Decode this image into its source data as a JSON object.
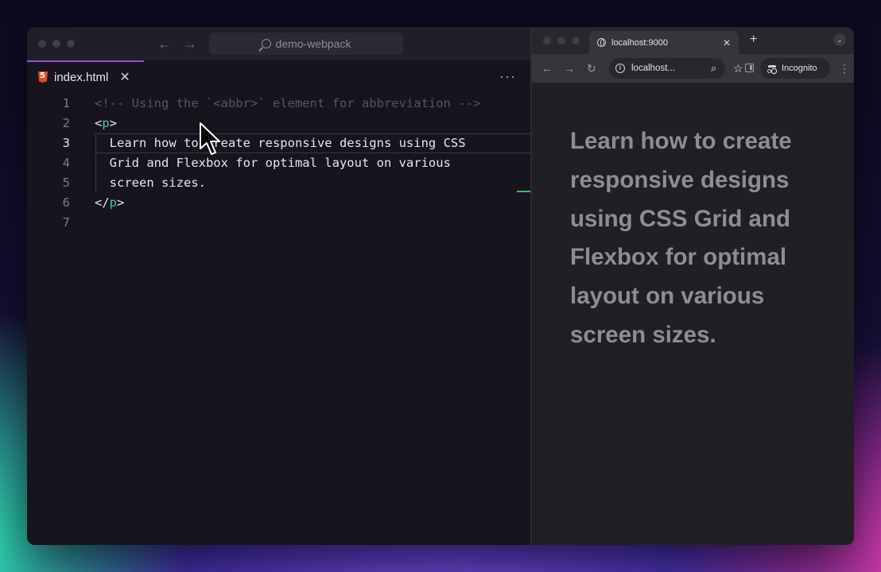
{
  "editor": {
    "search_text": "demo-webpack",
    "tab_label": "index.html",
    "more_label": "···",
    "lines": [
      {
        "num": "1",
        "parts": [
          {
            "t": "<!-- Using the `<abbr>` element for abbreviation -->",
            "c": "cmt"
          }
        ]
      },
      {
        "num": "2",
        "parts": [
          {
            "t": "<",
            "c": "punc"
          },
          {
            "t": "p",
            "c": "tagname"
          },
          {
            "t": ">",
            "c": "punc"
          }
        ]
      },
      {
        "num": "3",
        "parts": [
          {
            "t": "  Learn how to create responsive designs using CSS",
            "c": "punc"
          }
        ]
      },
      {
        "num": "4",
        "parts": [
          {
            "t": "  Grid and Flexbox for optimal layout on various",
            "c": "punc"
          }
        ]
      },
      {
        "num": "5",
        "parts": [
          {
            "t": "  screen sizes.",
            "c": "punc"
          }
        ]
      },
      {
        "num": "6",
        "parts": [
          {
            "t": "</",
            "c": "punc"
          },
          {
            "t": "p",
            "c": "tagname"
          },
          {
            "t": ">",
            "c": "punc"
          }
        ]
      },
      {
        "num": "7",
        "parts": []
      }
    ],
    "active_line": 3
  },
  "browser": {
    "tab_title": "localhost:9000",
    "address": "localhost...",
    "incognito_label": "Incognito",
    "paragraph": "Learn how to create responsive designs using CSS Grid and Flexbox for optimal layout on various screen sizes."
  },
  "colors": {
    "tab_accent": "#a24bd0",
    "tag_color": "#4fc1a4",
    "comment_color": "#555466",
    "diff_added": "#27c46a"
  }
}
